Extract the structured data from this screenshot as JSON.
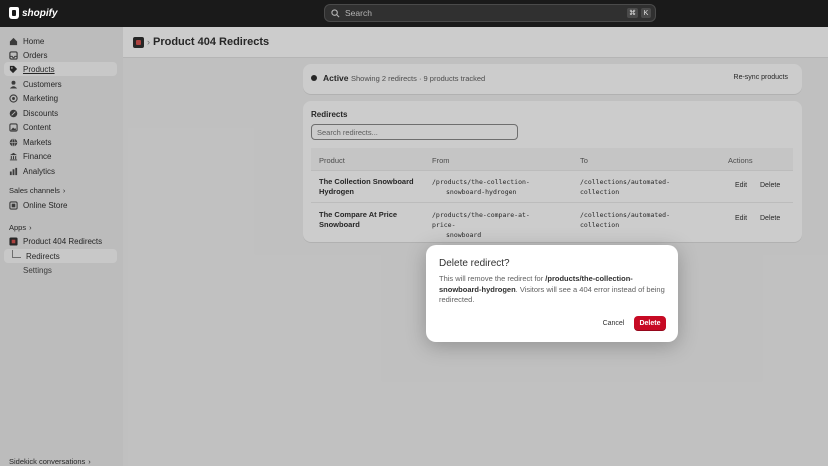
{
  "topbar": {
    "brand": "shopify",
    "search_label": "Search",
    "shortcut_keys": [
      "⌘",
      "K"
    ]
  },
  "sidebar": {
    "items": [
      {
        "label": "Home",
        "icon": "home-icon"
      },
      {
        "label": "Orders",
        "icon": "inbox-icon"
      },
      {
        "label": "Products",
        "icon": "tag-icon"
      },
      {
        "label": "Customers",
        "icon": "person-icon"
      },
      {
        "label": "Marketing",
        "icon": "target-icon"
      },
      {
        "label": "Discounts",
        "icon": "discount-icon"
      },
      {
        "label": "Content",
        "icon": "image-icon"
      },
      {
        "label": "Markets",
        "icon": "globe-icon"
      },
      {
        "label": "Finance",
        "icon": "bank-icon"
      },
      {
        "label": "Analytics",
        "icon": "chart-icon"
      }
    ],
    "sales_channels_label": "Sales channels",
    "online_store_label": "Online Store",
    "apps_label": "Apps",
    "app_name": "Product 404 Redirects",
    "app_sub_redirects": "Redirects",
    "app_sub_settings": "Settings",
    "sidekick_label": "Sidekick conversations"
  },
  "header": {
    "title": "Product 404 Redirects"
  },
  "status_card": {
    "status": "Active",
    "info": "Showing 2 redirects · 9 products tracked",
    "resync_label": "Re-sync products"
  },
  "redirects_card": {
    "title": "Redirects",
    "search_placeholder": "Search redirects...",
    "columns": [
      "Product",
      "From",
      "To",
      "Actions"
    ],
    "rows": [
      {
        "product_line1": "The Collection Snowboard",
        "product_line2": "Hydrogen",
        "from_line1": "/products/the-collection-",
        "from_line2": "snowboard-hydrogen",
        "to_line1": "/collections/automated-",
        "to_line2": "collection",
        "edit": "Edit",
        "delete": "Delete"
      },
      {
        "product_line1": "The Compare At Price",
        "product_line2": "Snowboard",
        "from_line1": "/products/the-compare-at-price-",
        "from_line2": "snowboard",
        "to_line1": "/collections/automated-",
        "to_line2": "collection",
        "edit": "Edit",
        "delete": "Delete"
      }
    ]
  },
  "modal": {
    "title": "Delete redirect?",
    "body_prefix": "This will remove the redirect for ",
    "body_path": "/products/the-collection-snowboard-hydrogen",
    "body_suffix": ". Visitors will see a 404 error instead of being redirected.",
    "cancel_label": "Cancel",
    "delete_label": "Delete"
  },
  "colors": {
    "topbar": "#1a1a1a",
    "destructive": "#c70a24",
    "sidebar": "#ebebeb"
  }
}
